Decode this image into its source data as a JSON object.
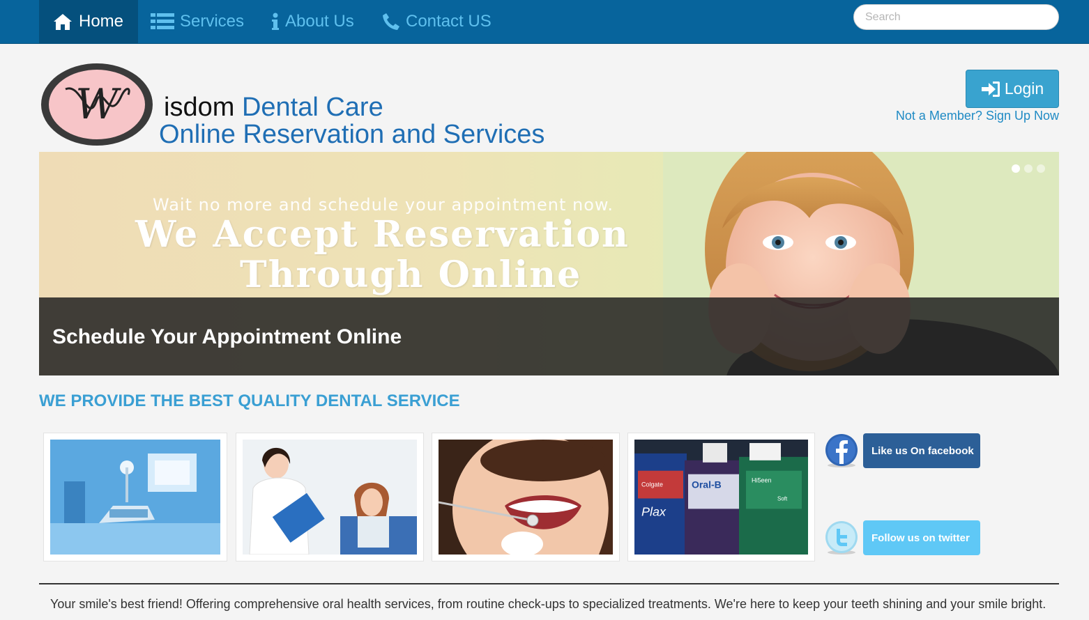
{
  "nav": {
    "home": "Home",
    "services": "Services",
    "about": "About Us",
    "contact": "Contact US"
  },
  "search": {
    "placeholder": "Search"
  },
  "logo": {
    "letter": "W"
  },
  "brand": {
    "prefix": "isdom",
    "name": "Dental Care",
    "tagline": "Online Reservation and Services"
  },
  "auth": {
    "login": "Login",
    "signup": "Not a Member? Sign Up Now"
  },
  "carousel": {
    "subtitle": "Wait no more and schedule your appointment now.",
    "headline_1": "We Accept Reservation",
    "headline_2": "Through Online",
    "caption": "Schedule Your Appointment Online",
    "slide_count": 3,
    "active_slide": 1
  },
  "section": {
    "title": "WE PROVIDE THE BEST QUALITY DENTAL SERVICE"
  },
  "gallery": {
    "mouthwash_labels": {
      "brand_a": "Colgate",
      "product_a": "Plax",
      "brand_b": "Oral-B",
      "brand_c": "Hi5een",
      "product_c": "Soft"
    }
  },
  "social": {
    "facebook": "Like us On facebook",
    "twitter": "Follow us on twitter"
  },
  "footer": {
    "text": "Your smile's best friend! Offering comprehensive oral health services, from routine check-ups to specialized treatments. We're here to keep your teeth shining and your smile bright."
  },
  "colors": {
    "navbar": "#07649c",
    "accent": "#3a9fd3",
    "brand_blue": "#1f6eb4",
    "facebook": "#2c5f97",
    "twitter": "#5fc8f6"
  }
}
